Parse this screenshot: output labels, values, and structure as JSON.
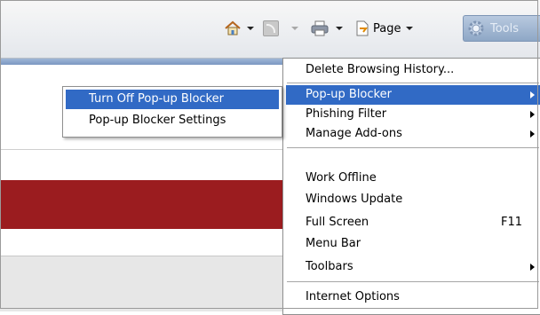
{
  "toolbar": {
    "page_label": "Page",
    "tools_label": "Tools"
  },
  "tools_menu": {
    "items": [
      {
        "label": "Delete Browsing History..."
      },
      {
        "label": "Pop-up Blocker",
        "submenu": true,
        "selected": true
      },
      {
        "label": "Phishing Filter",
        "submenu": true
      },
      {
        "label": "Manage Add-ons",
        "submenu": true
      },
      {
        "label": "Work Offline"
      },
      {
        "label": "Windows Update"
      },
      {
        "label": "Full Screen",
        "shortcut": "F11"
      },
      {
        "label": "Menu Bar"
      },
      {
        "label": "Toolbars",
        "submenu": true
      },
      {
        "label": "Internet Options"
      }
    ]
  },
  "popup_submenu": {
    "items": [
      {
        "label": "Turn Off Pop-up Blocker",
        "selected": true
      },
      {
        "label": "Pop-up Blocker Settings"
      }
    ]
  },
  "colors": {
    "selection": "#316ac5",
    "red_band": "#9b1c1f",
    "tools_button": "#8ea7c6"
  }
}
